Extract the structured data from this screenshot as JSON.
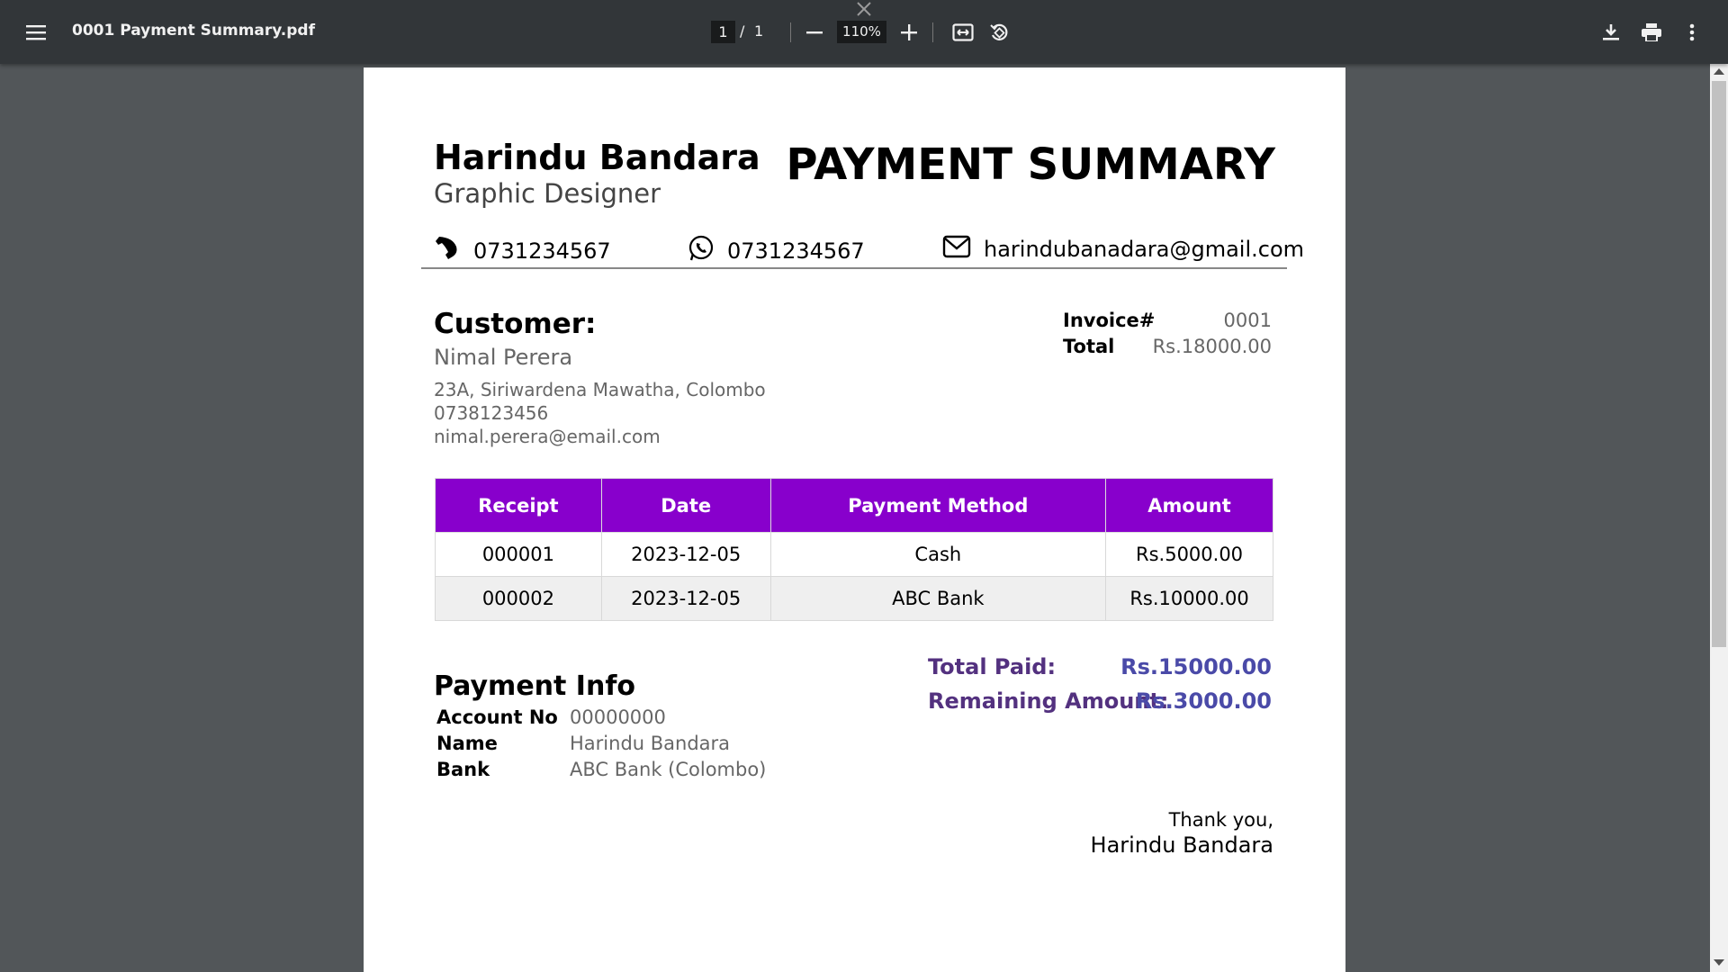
{
  "toolbar": {
    "title": "0001 Payment Summary.pdf",
    "page_current": "1",
    "page_separator": "/",
    "page_total": "1",
    "zoom": "110%",
    "icons": [
      "menu-icon",
      "close-icon",
      "zoom-out-icon",
      "zoom-in-icon",
      "fit-page-icon",
      "rotate-icon",
      "download-icon",
      "print-icon",
      "more-options-icon"
    ]
  },
  "doc": {
    "name": "Harindu Bandara",
    "role": "Graphic Designer",
    "heading": "PAYMENT SUMMARY",
    "phone": "0731234567",
    "whatsapp": "0731234567",
    "email": "harindubanadara@gmail.com",
    "customer_label": "Customer:",
    "customer_name": "Nimal Perera",
    "customer_address": "23A, Siriwardena Mawatha, Colombo",
    "customer_phone": "0738123456",
    "customer_email": "nimal.perera@email.com",
    "invoice_label": "Invoice#",
    "invoice_no": "0001",
    "total_label": "Total",
    "total_value": "Rs.18000.00",
    "table": {
      "headers": [
        "Receipt",
        "Date",
        "Payment Method",
        "Amount"
      ],
      "rows": [
        [
          "000001",
          "2023-12-05",
          "Cash",
          "Rs.5000.00"
        ],
        [
          "000002",
          "2023-12-05",
          "ABC Bank",
          "Rs.10000.00"
        ]
      ]
    },
    "payment_info": {
      "title": "Payment Info",
      "account_label": "Account No",
      "account_value": "00000000",
      "name_label": "Name",
      "name_value": "Harindu Bandara",
      "bank_label": "Bank",
      "bank_value": "ABC Bank (Colombo)"
    },
    "total_paid_label": "Total Paid:",
    "total_paid_value": "Rs.15000.00",
    "remaining_label": "Remaining Amount:",
    "remaining_value": "Rs.3000.00",
    "thanks": "Thank you,",
    "signature_name": "Harindu Bandara"
  },
  "colors": {
    "toolbar_bg": "#323639",
    "viewer_bg": "#525659",
    "table_header": "#8800cc",
    "totals_label": "#53317f",
    "totals_value": "#4a4aa8"
  }
}
